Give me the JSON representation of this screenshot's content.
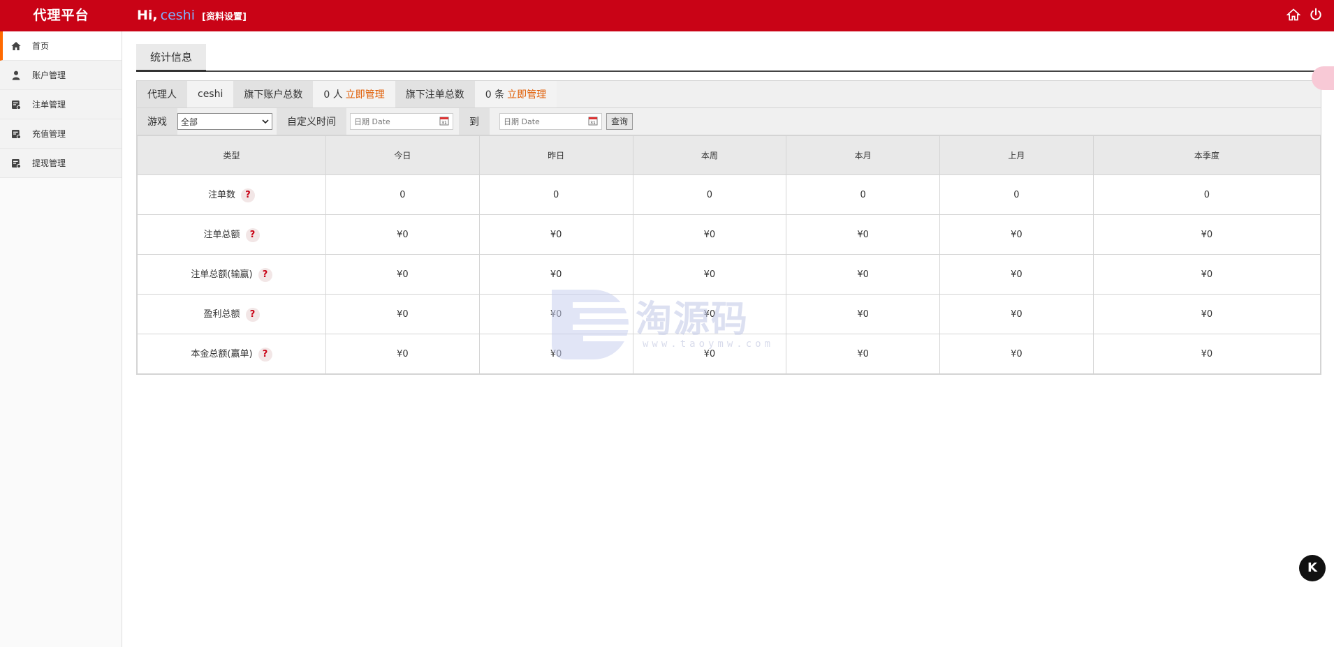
{
  "header": {
    "brand": "代理平台",
    "greeting": "Hi,",
    "username": "ceshi",
    "profile_link": "[资料设置]",
    "icons": [
      "home-icon",
      "power-icon"
    ]
  },
  "sidebar": {
    "items": [
      {
        "label": "首页",
        "icon": "home-icon",
        "active": true
      },
      {
        "label": "账户管理",
        "icon": "user-icon"
      },
      {
        "label": "注单管理",
        "icon": "ledger-icon"
      },
      {
        "label": "充值管理",
        "icon": "ledger-icon"
      },
      {
        "label": "提现管理",
        "icon": "ledger-icon"
      }
    ]
  },
  "tab": {
    "label": "统计信息"
  },
  "summary": {
    "agent_label": "代理人",
    "agent_value": "ceshi",
    "accounts_label": "旗下账户总数",
    "accounts_value": "0 人",
    "accounts_link": "立即管理",
    "orders_label": "旗下注单总数",
    "orders_value": "0 条",
    "orders_link": "立即管理"
  },
  "filter": {
    "game_label": "游戏",
    "game_selected": "全部",
    "time_label": "自定义时间",
    "date_placeholder": "日期 Date",
    "to_label": "到",
    "query_button": "查询"
  },
  "table": {
    "headers": [
      "类型",
      "今日",
      "昨日",
      "本周",
      "本月",
      "上月",
      "本季度"
    ],
    "rows": [
      {
        "label": "注单数",
        "values": [
          "0",
          "0",
          "0",
          "0",
          "0",
          "0"
        ]
      },
      {
        "label": "注单总额",
        "values": [
          "¥0",
          "¥0",
          "¥0",
          "¥0",
          "¥0",
          "¥0"
        ]
      },
      {
        "label": "注单总额(输赢)",
        "values": [
          "¥0",
          "¥0",
          "¥0",
          "¥0",
          "¥0",
          "¥0"
        ]
      },
      {
        "label": "盈利总额",
        "values": [
          "¥0",
          "¥0",
          "¥0",
          "¥0",
          "¥0",
          "¥0"
        ]
      },
      {
        "label": "本金总额(赢单)",
        "values": [
          "¥0",
          "¥0",
          "¥0",
          "¥0",
          "¥0",
          "¥0"
        ]
      }
    ],
    "help_mark": "?"
  },
  "watermark": {
    "text": "淘源码",
    "sub": "www.taoymw.com"
  },
  "floating": {
    "k_label": "K"
  },
  "colors": {
    "header_bg": "#c90316",
    "accent_link": "#e05b00",
    "active_marker": "#ff6a00"
  }
}
